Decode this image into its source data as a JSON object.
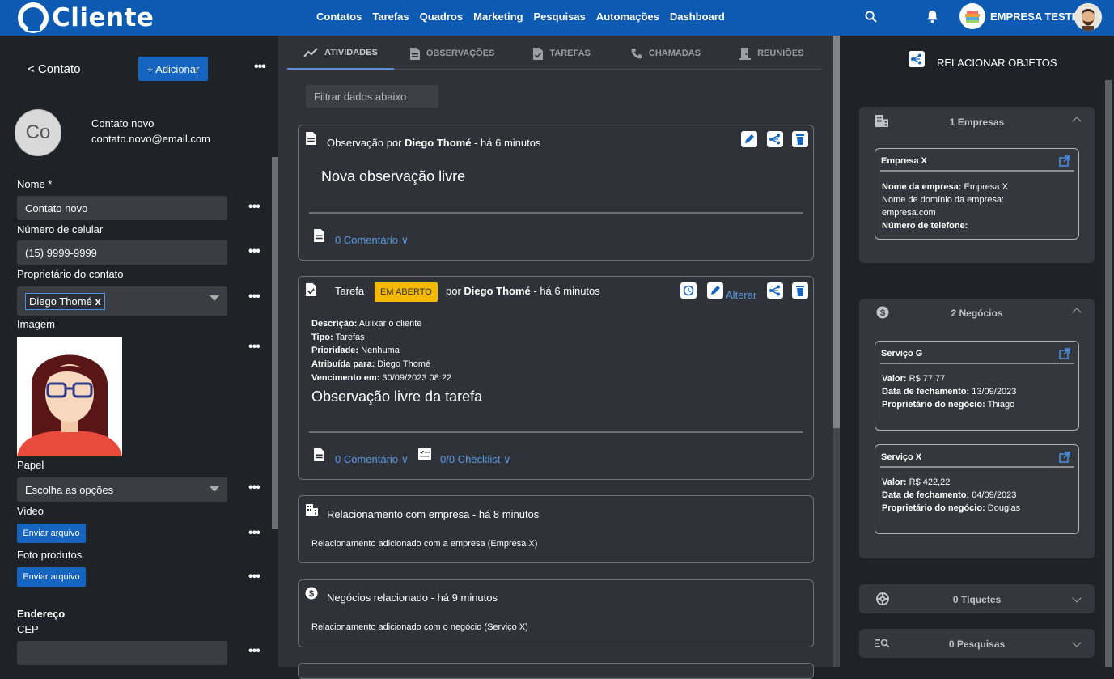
{
  "brand": {
    "name": "Cliente"
  },
  "nav": [
    "Contatos",
    "Tarefas",
    "Quadros",
    "Marketing",
    "Pesquisas",
    "Automações",
    "Dashboard"
  ],
  "company": {
    "name": "EMPRESA TESTE"
  },
  "left": {
    "back_label": "< Contato",
    "add_label": "+ Adicionar",
    "avatar_initials": "Co",
    "contact_name": "Contato novo",
    "contact_email": "contato.novo@email.com",
    "fields": {
      "nome_label": "Nome *",
      "nome_value": "Contato novo",
      "celular_label": "Número de celular",
      "celular_value": "(15) 9999-9999",
      "proprietario_label": "Proprietário do contato",
      "proprietario_chip": "Diego Thomé",
      "proprietario_chip_remove": "x",
      "imagem_label": "Imagem",
      "papel_label": "Papel",
      "papel_value": "Escolha as opções",
      "video_label": "Video",
      "upload_label": "Enviar arquivo",
      "foto_label": "Foto produtos",
      "endereco_label": "Endereço",
      "cep_label": "CEP"
    }
  },
  "tabs": [
    {
      "label": "ATIVIDADES",
      "icon": "chart-line-icon",
      "active": true
    },
    {
      "label": "OBSERVAÇÕES",
      "icon": "document-icon",
      "active": false
    },
    {
      "label": "TAREFAS",
      "icon": "task-icon",
      "active": false
    },
    {
      "label": "CHAMADAS",
      "icon": "phone-icon",
      "active": false
    },
    {
      "label": "REUNIÕES",
      "icon": "door-icon",
      "active": false
    }
  ],
  "filter_placeholder": "Filtrar dados abaixo",
  "activities": {
    "obs": {
      "prefix": "Observação por",
      "author": "Diego Thomé",
      "time": "- há 6 minutos",
      "body": "Nova observação livre",
      "comments": "0 Comentário ∨"
    },
    "task": {
      "prefix": "Tarefa",
      "badge": "EM ABERTO",
      "by": "por",
      "author": "Diego Thomé",
      "time": "- há 6 minutos",
      "alter": "Alterar",
      "descricao_k": "Descrição:",
      "descricao_v": "Aulixar o cliente",
      "tipo_k": "Tipo:",
      "tipo_v": "Tarefas",
      "prioridade_k": "Prioridade:",
      "prioridade_v": "Nenhuma",
      "atribuida_k": "Atribuída para:",
      "atribuida_v": "Diego Thomé",
      "venc_k": "Vencimento em:",
      "venc_v": "30/09/2023 08:22",
      "body": "Observação livre da tarefa",
      "comments": "0 Comentário ∨",
      "checklist": "0/0 Checklist ∨"
    },
    "rel_empresa": {
      "title": "Relacionamento com empresa - há 8 minutos",
      "body": "Relacionamento adicionado com a empresa (Empresa X)"
    },
    "rel_negocio": {
      "title": "Negócios relacionado - há 9 minutos",
      "body": "Relacionamento adicionado com o negócio (Serviço X)"
    }
  },
  "right": {
    "title": "RELACIONAR OBJETOS",
    "empresas": {
      "head": "1 Empresas",
      "card_title": "Empresa X",
      "nome_k": "Nome da empresa:",
      "nome_v": "Empresa X",
      "dominio_k": "Nome de domínio da empresa:",
      "dominio_v": "empresa.com",
      "telefone_k": "Número de telefone:"
    },
    "negocios": {
      "head": "2 Negócios",
      "items": [
        {
          "title": "Serviço G",
          "valor_k": "Valor:",
          "valor_v": "R$ 77,77",
          "data_k": "Data de fechamento:",
          "data_v": "13/09/2023",
          "prop_k": "Proprietário do negócio:",
          "prop_v": "Thiago"
        },
        {
          "title": "Serviço X",
          "valor_k": "Valor:",
          "valor_v": "R$ 422,22",
          "data_k": "Data de fechamento:",
          "data_v": "04/09/2023",
          "prop_k": "Proprietário do negócio:",
          "prop_v": "Douglas"
        }
      ]
    },
    "tiquetes": {
      "head": "0 Tíquetes"
    },
    "pesquisas": {
      "head": "0 Pesquisas"
    }
  },
  "colors": {
    "primary": "#0d5ab3",
    "badge": "#f5b800",
    "link": "#5a9ae0"
  }
}
